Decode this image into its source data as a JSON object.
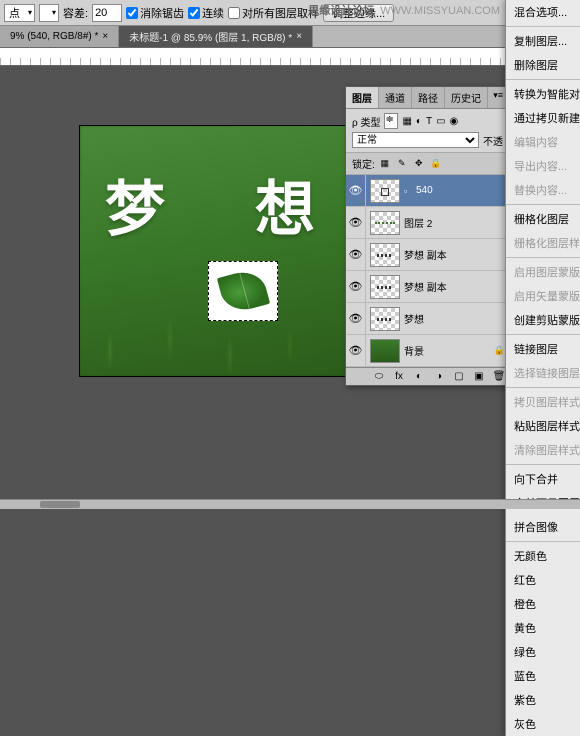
{
  "watermark": {
    "title": "思缘设计论坛",
    "url": "WWW.MISSYUAN.COM"
  },
  "toolbar": {
    "dropdown1": "点",
    "tolerance_label": "容差:",
    "tolerance_value": "20",
    "antialias": "消除锯齿",
    "contiguous": "连续",
    "sample_all": "对所有图层取样",
    "refine": "调整边缘..."
  },
  "tabs": {
    "t1": "9% (540, RGB/8#) *",
    "t2": "未标题-1 @ 85.9% (图层 1, RGB/8) *"
  },
  "canvas": {
    "char1": "梦",
    "char2": "想"
  },
  "panel": {
    "tabs": {
      "layers": "图层",
      "channels": "通道",
      "paths": "路径",
      "history": "历史记"
    },
    "kind_label": "ρ 类型",
    "blend": "正常",
    "opacity_label": "不透",
    "lock_label": "锁定:",
    "layers": [
      {
        "name": "540",
        "sel": true,
        "thumb": "box"
      },
      {
        "name": "图层 2",
        "thumb": "dots2"
      },
      {
        "name": "梦想 副本",
        "thumb": "dots"
      },
      {
        "name": "梦想 副本",
        "thumb": "dots"
      },
      {
        "name": "梦想",
        "thumb": "dots"
      },
      {
        "name": "背景",
        "thumb": "grass",
        "locked": true
      }
    ]
  },
  "ctx": [
    {
      "t": "混合选项...",
      "dis": false
    },
    {
      "sep": 1
    },
    {
      "t": "复制图层...",
      "dis": false
    },
    {
      "t": "删除图层",
      "dis": false
    },
    {
      "sep": 1
    },
    {
      "t": "转换为智能对",
      "dis": false
    },
    {
      "t": "通过拷贝新建",
      "dis": false
    },
    {
      "t": "编辑内容",
      "dis": true
    },
    {
      "t": "导出内容...",
      "dis": true
    },
    {
      "t": "替换内容...",
      "dis": true
    },
    {
      "sep": 1
    },
    {
      "t": "栅格化图层",
      "dis": false
    },
    {
      "t": "栅格化图层样",
      "dis": true
    },
    {
      "sep": 1
    },
    {
      "t": "启用图层蒙版",
      "dis": true
    },
    {
      "t": "启用矢量蒙版",
      "dis": true
    },
    {
      "t": "创建剪贴蒙版",
      "dis": false
    },
    {
      "sep": 1
    },
    {
      "t": "链接图层",
      "dis": false
    },
    {
      "t": "选择链接图层",
      "dis": true
    },
    {
      "sep": 1
    },
    {
      "t": "拷贝图层样式",
      "dis": true
    },
    {
      "t": "粘贴图层样式",
      "dis": false
    },
    {
      "t": "清除图层样式",
      "dis": true
    },
    {
      "sep": 1
    },
    {
      "t": "向下合并",
      "dis": false
    },
    {
      "t": "合并可见图层",
      "dis": false
    },
    {
      "t": "拼合图像",
      "dis": false
    },
    {
      "sep": 1
    },
    {
      "t": "无颜色",
      "dis": false
    },
    {
      "t": "红色",
      "dis": false
    },
    {
      "t": "橙色",
      "dis": false
    },
    {
      "t": "黄色",
      "dis": false
    },
    {
      "t": "绿色",
      "dis": false
    },
    {
      "t": "蓝色",
      "dis": false
    },
    {
      "t": "紫色",
      "dis": false
    },
    {
      "t": "灰色",
      "dis": false
    }
  ]
}
